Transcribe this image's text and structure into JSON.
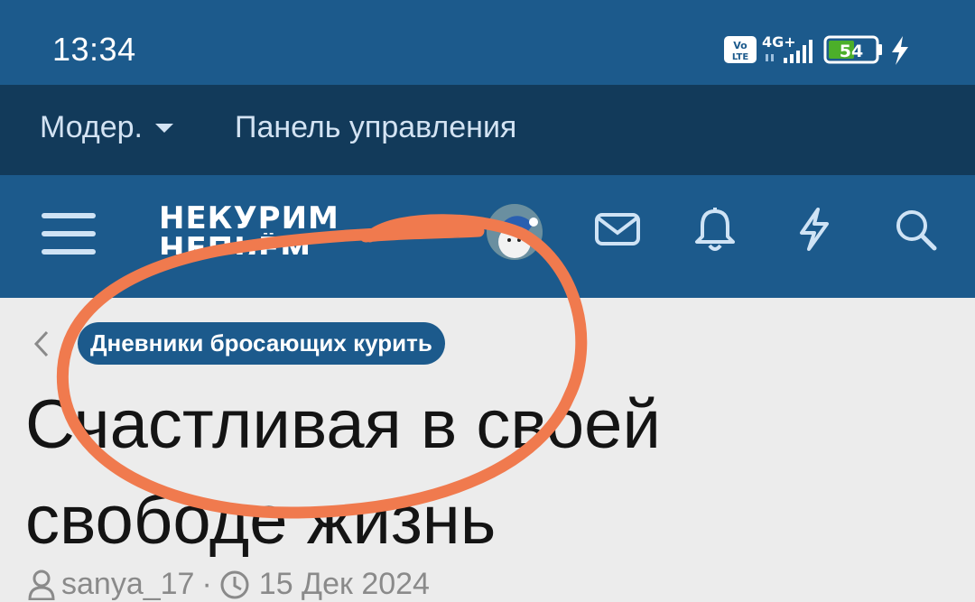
{
  "status_bar": {
    "time": "13:34",
    "volte_label": "Vo LTE",
    "network_label": "4G+",
    "battery_level": "54",
    "battery_percent": 54,
    "icons": [
      "volte-icon",
      "signal-icon",
      "battery-icon",
      "charging-icon"
    ]
  },
  "moderator_bar": {
    "moderator_label": "Модер.",
    "control_panel_label": "Панель управления"
  },
  "nav": {
    "logo_line1": "НЕКУРИМ",
    "logo_line2": "НЕПЬЁМ",
    "icons": [
      "menu-icon",
      "avatar",
      "mail-icon",
      "bell-icon",
      "lightning-icon",
      "search-icon"
    ]
  },
  "thread": {
    "category": "Дневники бросающих курить",
    "title": "Счастливая в своей свободе жизнь",
    "author": "sanya_17",
    "separator": "·",
    "date": "15 Дек 2024"
  },
  "colors": {
    "header_blue": "#1c5a8c",
    "moderator_bar": "#123a5a",
    "annotation": "#f07a4e",
    "battery_green": "#4caf2a"
  }
}
